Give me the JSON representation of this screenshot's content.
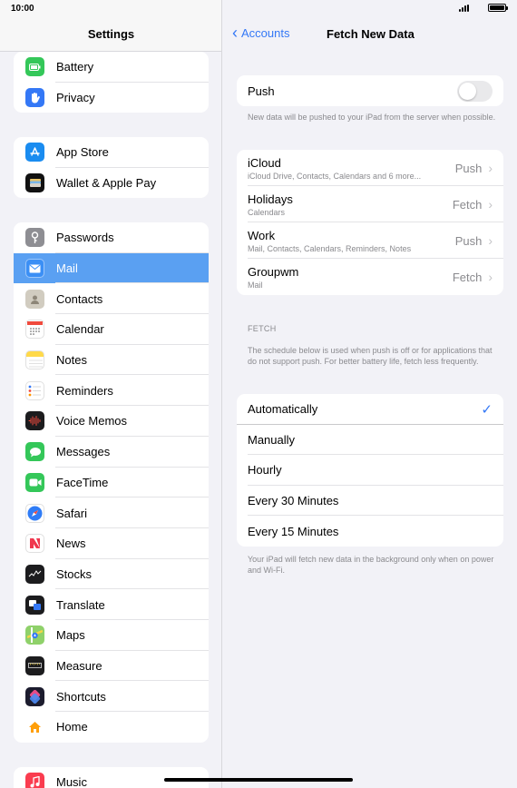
{
  "status": {
    "time": "10:00"
  },
  "sidebar": {
    "title": "Settings",
    "groups": [
      [
        {
          "label": "Battery",
          "icon": "battery-icon",
          "color": "#34c759"
        },
        {
          "label": "Privacy",
          "icon": "hand-icon",
          "color": "#3478f6"
        }
      ],
      [
        {
          "label": "App Store",
          "icon": "app-store-icon",
          "color": "#1a8cf0"
        },
        {
          "label": "Wallet & Apple Pay",
          "icon": "wallet-icon",
          "color": "#111111"
        }
      ],
      [
        {
          "label": "Passwords",
          "icon": "key-icon",
          "color": "#8e8e93"
        },
        {
          "label": "Mail",
          "icon": "mail-icon",
          "color": "#3b8ff5"
        },
        {
          "label": "Contacts",
          "icon": "contacts-icon",
          "color": "#bdb7a9"
        },
        {
          "label": "Calendar",
          "icon": "calendar-icon",
          "color": "#ffffff"
        },
        {
          "label": "Notes",
          "icon": "notes-icon",
          "color": "#ffd94a"
        },
        {
          "label": "Reminders",
          "icon": "reminders-icon",
          "color": "#ffffff"
        },
        {
          "label": "Voice Memos",
          "icon": "waveform-icon",
          "color": "#1c1c1e"
        },
        {
          "label": "Messages",
          "icon": "message-bubble-icon",
          "color": "#34c759"
        },
        {
          "label": "FaceTime",
          "icon": "video-camera-icon",
          "color": "#34c759"
        },
        {
          "label": "Safari",
          "icon": "compass-icon",
          "color": "#2f7cf6"
        },
        {
          "label": "News",
          "icon": "news-icon",
          "color": "#ffffff"
        },
        {
          "label": "Stocks",
          "icon": "chart-line-icon",
          "color": "#1c1c1e"
        },
        {
          "label": "Translate",
          "icon": "translate-icon",
          "color": "#1c1c1e"
        },
        {
          "label": "Maps",
          "icon": "map-icon",
          "color": "#8fd16a"
        },
        {
          "label": "Measure",
          "icon": "ruler-icon",
          "color": "#1c1c1e"
        },
        {
          "label": "Shortcuts",
          "icon": "shortcuts-icon",
          "color": "#5d4be3"
        },
        {
          "label": "Home",
          "icon": "house-icon",
          "color": "#ffffff"
        }
      ],
      [
        {
          "label": "Music",
          "icon": "music-note-icon",
          "color": "#fa3c4f"
        }
      ]
    ],
    "selected": "Mail"
  },
  "nav": {
    "back_label": "Accounts",
    "title": "Fetch New Data"
  },
  "push": {
    "label": "Push",
    "enabled": false,
    "note": "New data will be pushed to your iPad from the server when possible."
  },
  "accounts": [
    {
      "name": "iCloud",
      "sub": "iCloud Drive, Contacts, Calendars and 6 more...",
      "value": "Push"
    },
    {
      "name": "Holidays",
      "sub": "Calendars",
      "value": "Fetch"
    },
    {
      "name": "Work",
      "sub": "Mail, Contacts, Calendars, Reminders, Notes",
      "value": "Push"
    },
    {
      "name": "Groupwm",
      "sub": "Mail",
      "value": "Fetch"
    }
  ],
  "fetch": {
    "header": "FETCH",
    "description": "The schedule below is used when push is off or for applications that do not support push. For better battery life, fetch less frequently.",
    "options": [
      "Automatically",
      "Manually",
      "Hourly",
      "Every 30 Minutes",
      "Every 15 Minutes"
    ],
    "selected": "Automatically",
    "footer": "Your iPad will fetch new data in the background only when on power and Wi-Fi."
  },
  "colors": {
    "accent": "#3478f6",
    "selected_row": "#5aa0f2"
  }
}
